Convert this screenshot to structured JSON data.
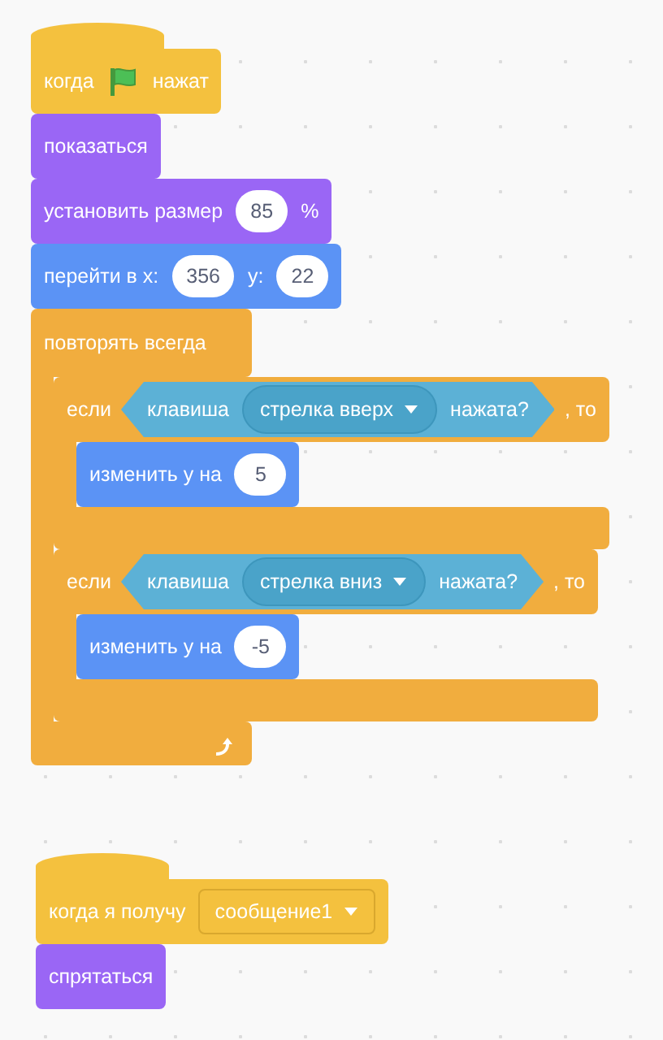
{
  "scripts": [
    {
      "blocks": [
        {
          "kind": "hat",
          "color": "#f4c13e",
          "parts": [
            {
              "kind": "text",
              "text": "когда"
            },
            {
              "kind": "flag"
            },
            {
              "kind": "text",
              "text": "нажат"
            }
          ]
        },
        {
          "kind": "stack",
          "color": "#9a66f5",
          "parts": [
            {
              "kind": "text",
              "text": "показаться"
            }
          ]
        },
        {
          "kind": "stack",
          "color": "#9a66f5",
          "parts": [
            {
              "kind": "text",
              "text": "установить размер"
            },
            {
              "kind": "number",
              "text": "85"
            },
            {
              "kind": "text",
              "text": "%"
            }
          ]
        },
        {
          "kind": "stack",
          "color": "#5b93f5",
          "parts": [
            {
              "kind": "text",
              "text": "перейти в x:"
            },
            {
              "kind": "number",
              "text": "356"
            },
            {
              "kind": "text",
              "text": "y:"
            },
            {
              "kind": "number",
              "text": "22"
            }
          ]
        },
        {
          "kind": "forever",
          "color": "#f1ad3e",
          "parts": [
            {
              "kind": "text",
              "text": "повторять всегда"
            }
          ],
          "children": [
            {
              "kind": "if",
              "color": "#f1ad3e",
              "parts": [
                {
                  "kind": "text",
                  "text": "если"
                },
                {
                  "kind": "boolean",
                  "color": "#5cb1d6",
                  "parts": [
                    {
                      "kind": "text",
                      "text": "клавиша"
                    },
                    {
                      "kind": "dropdown",
                      "text": "стрелка вверх"
                    },
                    {
                      "kind": "text",
                      "text": "нажата?"
                    }
                  ]
                },
                {
                  "kind": "text",
                  "text": ", то"
                }
              ],
              "children": [
                {
                  "kind": "stack",
                  "color": "#5b93f5",
                  "parts": [
                    {
                      "kind": "text",
                      "text": "изменить y на"
                    },
                    {
                      "kind": "number",
                      "text": "5"
                    }
                  ]
                }
              ]
            },
            {
              "kind": "if",
              "color": "#f1ad3e",
              "parts": [
                {
                  "kind": "text",
                  "text": "если"
                },
                {
                  "kind": "boolean",
                  "color": "#5cb1d6",
                  "parts": [
                    {
                      "kind": "text",
                      "text": "клавиша"
                    },
                    {
                      "kind": "dropdown",
                      "text": "стрелка вниз"
                    },
                    {
                      "kind": "text",
                      "text": "нажата?"
                    }
                  ]
                },
                {
                  "kind": "text",
                  "text": ", то"
                }
              ],
              "children": [
                {
                  "kind": "stack",
                  "color": "#5b93f5",
                  "parts": [
                    {
                      "kind": "text",
                      "text": "изменить y на"
                    },
                    {
                      "kind": "number",
                      "text": "-5"
                    }
                  ]
                }
              ]
            }
          ]
        }
      ]
    },
    {
      "blocks": [
        {
          "kind": "hat",
          "color": "#f4c13e",
          "parts": [
            {
              "kind": "text",
              "text": "когда я получу"
            },
            {
              "kind": "menu",
              "text": "сообщение1"
            }
          ]
        },
        {
          "kind": "stack",
          "color": "#9a66f5",
          "parts": [
            {
              "kind": "text",
              "text": "спрятаться"
            }
          ]
        }
      ]
    }
  ]
}
